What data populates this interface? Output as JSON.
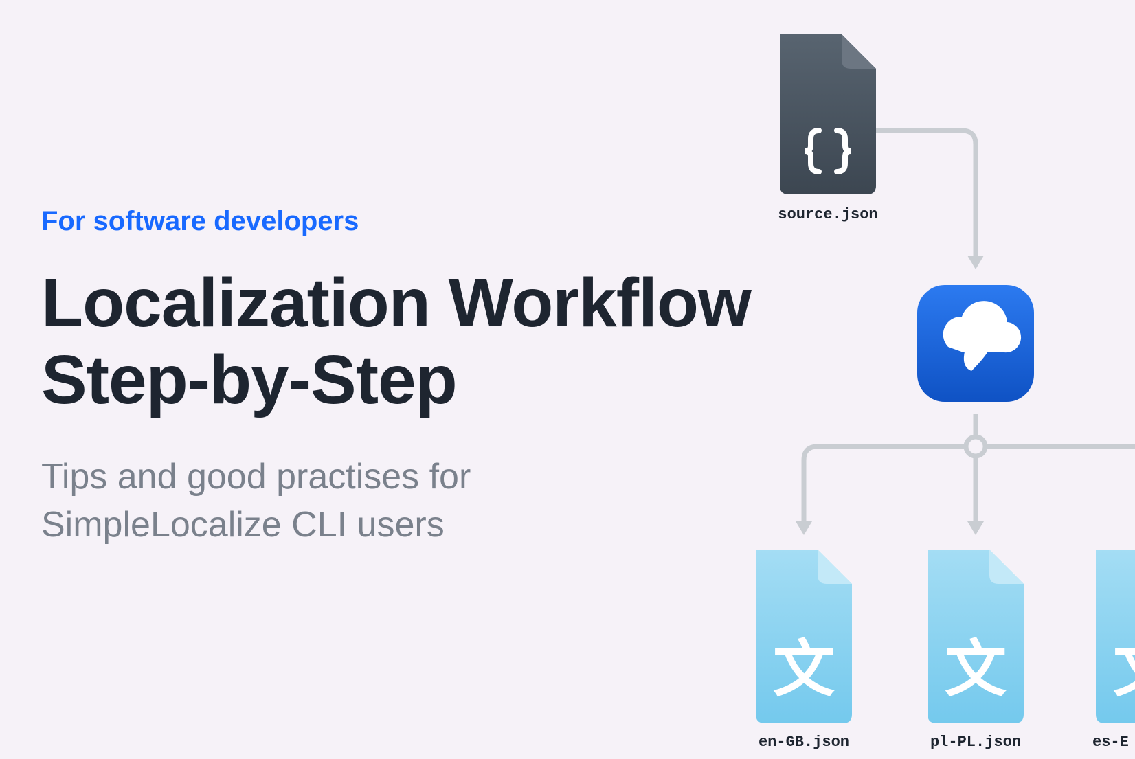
{
  "eyebrow": "For software developers",
  "title_line1": "Localization Workflow",
  "title_line2": "Step-by-Step",
  "subtitle_line1": "Tips and good practises for",
  "subtitle_line2": "SimpleLocalize CLI users",
  "source_file_label": "source.json",
  "output_files": [
    {
      "label": "en-GB.json"
    },
    {
      "label": "pl-PL.json"
    },
    {
      "label": "es-E"
    }
  ],
  "colors": {
    "background": "#f6f2f8",
    "accent_blue": "#1869ff",
    "heading": "#1e2530",
    "subheading": "#7a818c",
    "source_file_fill": "#47535f",
    "source_file_fold": "#6c7682",
    "app_tile": "#1560d6",
    "output_file_fill": "#8ed3f0",
    "output_file_fold": "#b6e2f5",
    "connector": "#c9cdd2"
  }
}
